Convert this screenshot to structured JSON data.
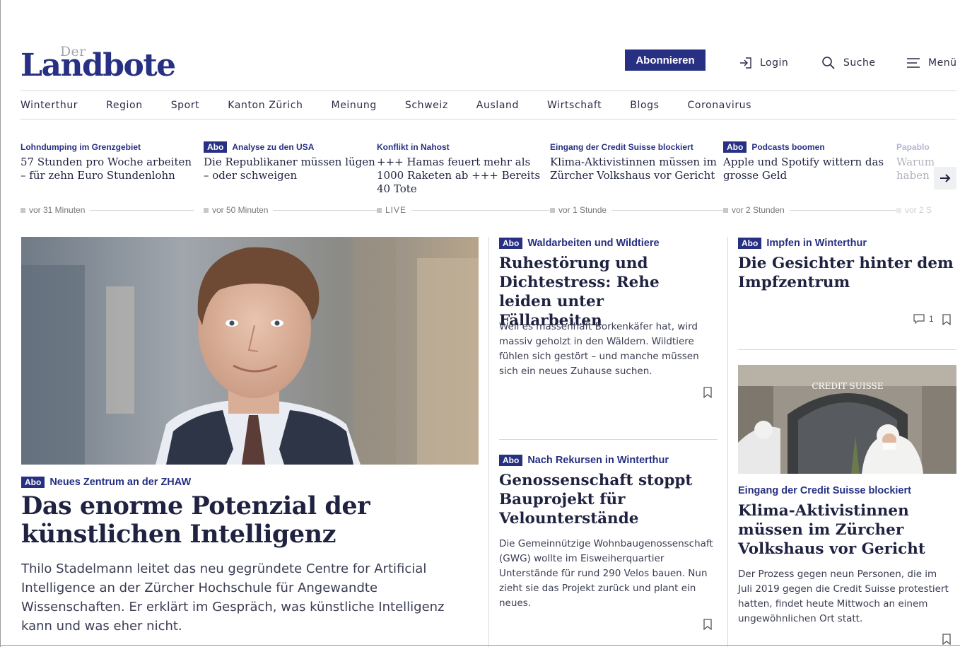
{
  "brand": {
    "logo_top": "Der",
    "logo_main": "Landbote",
    "accent": "#273082"
  },
  "header": {
    "subscribe_label": "Abonnieren",
    "login_label": "Login",
    "search_label": "Suche",
    "menu_label": "Menü"
  },
  "nav": [
    "Winterthur",
    "Region",
    "Sport",
    "Kanton Zürich",
    "Meinung",
    "Schweiz",
    "Ausland",
    "Wirtschaft",
    "Blogs",
    "Coronavirus"
  ],
  "ticker": [
    {
      "abo": "",
      "kicker": "Lohndumping im Grenzgebiet",
      "title": "57 Stunden pro Woche arbeiten – für zehn Euro Stundenlohn",
      "time": "vor 31 Minuten"
    },
    {
      "abo": "Abo",
      "kicker": "Analyse zu den USA",
      "title": "Die Republikaner müssen lügen – oder schweigen",
      "time": "vor 50 Minuten"
    },
    {
      "abo": "",
      "kicker": "Konflikt in Nahost",
      "title": "+++ Hamas feuert mehr als 1000 Raketen ab +++ Bereits 40 Tote",
      "time": "LIVE"
    },
    {
      "abo": "",
      "kicker": "Eingang der Credit Suisse blockiert",
      "title": "Klima-Aktivistinnen müssen im Zürcher Volkshaus vor Gericht",
      "time": "vor 1 Stunde"
    },
    {
      "abo": "Abo",
      "kicker": "Podcasts boomen",
      "title": "Apple und Spotify wittern das grosse Geld",
      "time": "vor 2 Stunden"
    },
    {
      "abo": "",
      "kicker": "Papablo",
      "title": "Warum haben",
      "time": "vor 2 S"
    }
  ],
  "hero": {
    "abo": "Abo",
    "kicker": "Neues Zentrum an der ZHAW",
    "title": "Das enorme Potenzial der künstlichen Intelligenz",
    "lead": "Thilo Stadelmann leitet das neu gegründete Centre for Artificial Intelligence an der Zürcher Hochschule für Angewandte Wissenschaften. Er erklärt im Gespräch, was künstliche Intelligenz kann und was eher nicht."
  },
  "middle": [
    {
      "abo": "Abo",
      "kicker": "Waldarbeiten und Wildtiere",
      "title": "Ruhestörung und Dichtestress: Rehe leiden unter Fällarbeiten",
      "lead": "Weil es massenhaft Borkenkäfer hat, wird massiv geholzt in den Wäldern. Wildtiere fühlen sich gestört – und manche müssen sich ein neues Zuhause suchen."
    },
    {
      "abo": "Abo",
      "kicker": "Nach Rekursen in Winterthur",
      "title": "Genossenschaft stoppt Bauprojekt für Velounterstände",
      "lead": "Die Gemeinnützige Wohnbaugenossenschaft (GWG) wollte im Eisweiherquartier Unterstände für rund 290 Velos bauen. Nun zieht sie das Projekt zurück und plant ein neues."
    }
  ],
  "right": [
    {
      "abo": "Abo",
      "kicker": "Impfen in Winterthur",
      "title": "Die Gesichter hinter dem Impfzentrum",
      "comments": "1"
    },
    {
      "abo": "",
      "kicker": "Eingang der Credit Suisse blockiert",
      "title": "Klima-Aktivistinnen müssen im Zürcher Volkshaus vor Gericht",
      "lead": "Der Prozess gegen neun Personen, die im Juli 2019 gegen die Credit Suisse protestiert hatten, findet heute Mittwoch an einem ungewöhnlichen Ort statt.",
      "image_sign": "CREDIT SUISSE"
    }
  ]
}
